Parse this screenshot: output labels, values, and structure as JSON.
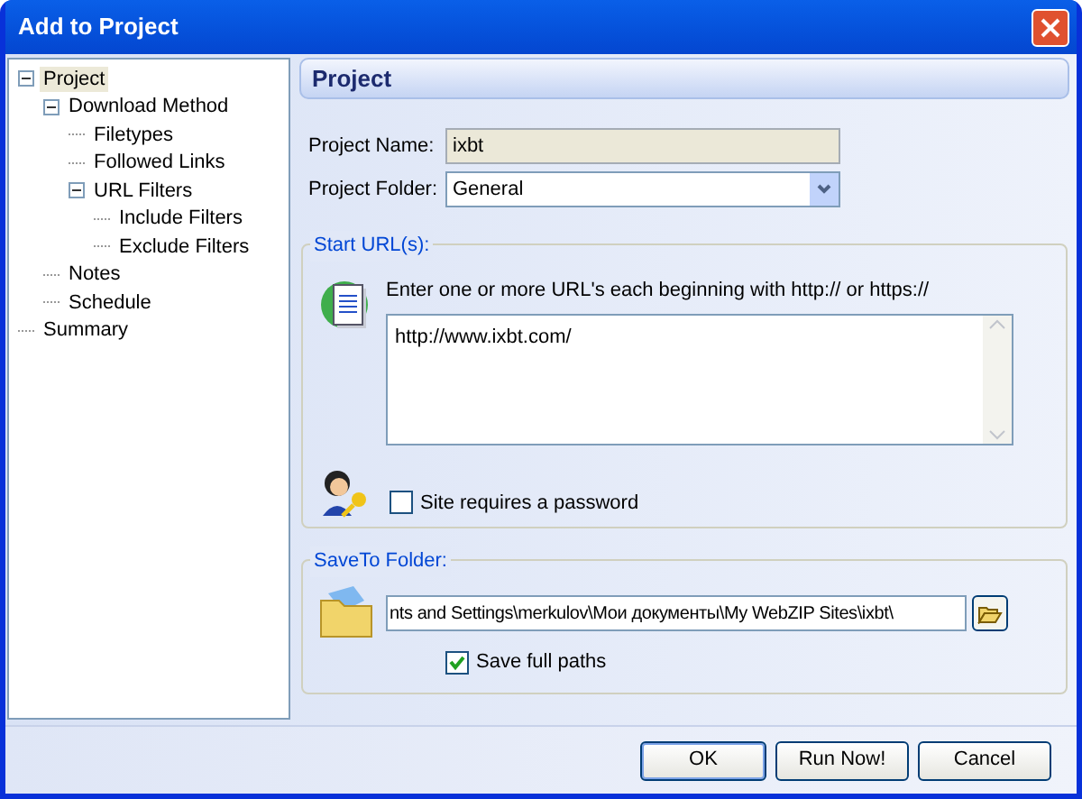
{
  "window": {
    "title": "Add to Project"
  },
  "tree": [
    {
      "label": "Project",
      "selected": true,
      "expanded": true,
      "children": [
        {
          "label": "Download Method",
          "selected": false,
          "expanded": true,
          "children": [
            {
              "label": "Filetypes",
              "selected": false
            },
            {
              "label": "Followed Links",
              "selected": false
            },
            {
              "label": "URL Filters",
              "selected": false,
              "expanded": true,
              "children": [
                {
                  "label": "Include Filters",
                  "selected": false
                },
                {
                  "label": "Exclude Filters",
                  "selected": false
                }
              ]
            }
          ]
        },
        {
          "label": "Notes",
          "selected": false
        },
        {
          "label": "Schedule",
          "selected": false
        }
      ]
    },
    {
      "label": "Summary",
      "selected": false
    }
  ],
  "header": "Project",
  "project_name": {
    "label": "Project Name:",
    "value": "ixbt"
  },
  "project_folder": {
    "label": "Project Folder:",
    "value": "General"
  },
  "start_urls": {
    "title": "Start URL(s):",
    "hint": "Enter one or more URL's each beginning with http:// or https://",
    "value": "http://www.ixbt.com/",
    "password_label": "Site requires a password",
    "password_checked": false
  },
  "save_to": {
    "title": "SaveTo Folder:",
    "value": "nts and Settings\\merkulov\\Мои документы\\My WebZIP Sites\\ixbt\\",
    "full_paths_label": "Save full paths",
    "full_paths_checked": true
  },
  "buttons": [
    "OK",
    "Run Now!",
    "Cancel"
  ]
}
